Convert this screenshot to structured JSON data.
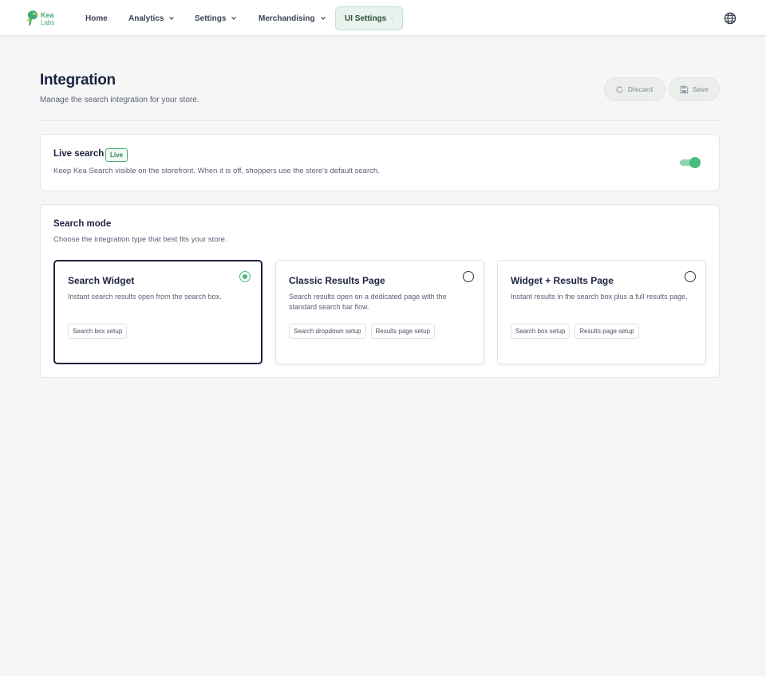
{
  "brand": {
    "name_top": "Kea",
    "name_bottom": "Labs",
    "accent": "#3fae74"
  },
  "nav": {
    "items": [
      {
        "label": "Home",
        "has_menu": false,
        "active": false
      },
      {
        "label": "Analytics",
        "has_menu": true,
        "active": false
      },
      {
        "label": "Settings",
        "has_menu": true,
        "active": false
      },
      {
        "label": "Merchandising",
        "has_menu": true,
        "active": false
      },
      {
        "label": "UI Settings",
        "has_menu": true,
        "active": true
      }
    ],
    "language_icon": "globe-icon"
  },
  "header": {
    "title": "Integration",
    "subtitle": "Manage the search integration for your store.",
    "discard_label": "Discard",
    "save_label": "Save"
  },
  "live_search": {
    "title": "Live search",
    "badge": "Live",
    "description": "Keep Kea Search visible on the storefront. When it is off, shoppers use the store's default search.",
    "enabled": true
  },
  "search_mode": {
    "title": "Search mode",
    "description": "Choose the integration type that best fits your store.",
    "selected_index": 0,
    "options": [
      {
        "title": "Search Widget",
        "description": "Instant search results open from the search box.",
        "tags": [
          "Search box setup"
        ]
      },
      {
        "title": "Classic Results Page",
        "description": "Search results open on a dedicated page with the standard search bar flow.",
        "tags": [
          "Search dropdown setup",
          "Results page setup"
        ]
      },
      {
        "title": "Widget + Results Page",
        "description": "Instant results in the search box plus a full results page.",
        "tags": [
          "Search box setup",
          "Results page setup"
        ]
      }
    ]
  }
}
